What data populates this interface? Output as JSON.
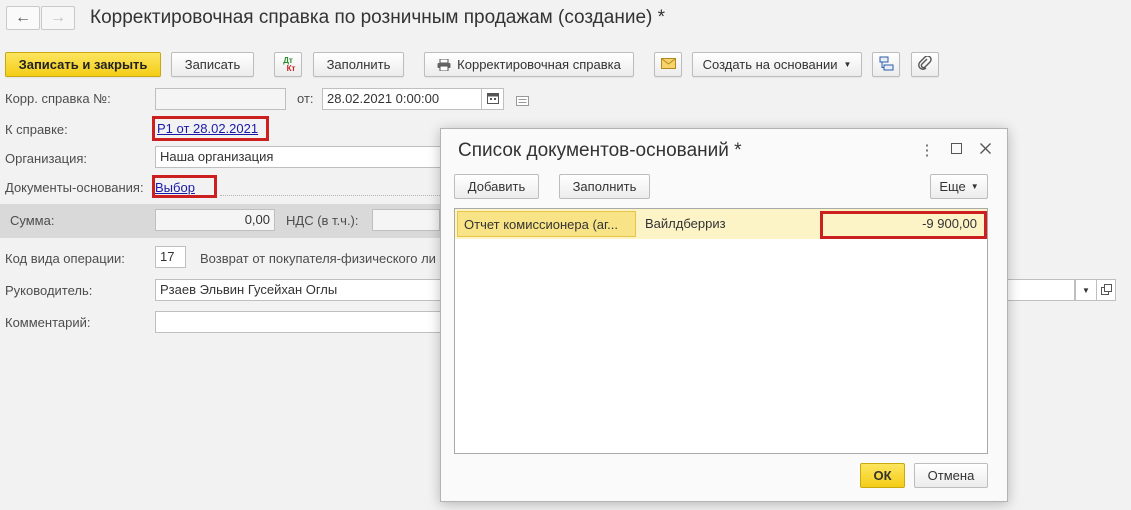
{
  "header": {
    "back_glyph": "←",
    "forward_glyph": "→",
    "title": "Корректировочная справка по розничным продажам (создание) *"
  },
  "toolbar": {
    "save_close": "Записать и закрыть",
    "save": "Записать",
    "dt_kt_top": "Дт",
    "dt_kt_bottom": "Кт",
    "fill": "Заполнить",
    "print_label": "Корректировочная справка",
    "create_based": "Создать на основании"
  },
  "form": {
    "corr_number_label": "Корр. справка №:",
    "corr_number_value": "",
    "date_label": "от:",
    "date_value": "28.02.2021  0:00:00",
    "to_ref_label": "К справке:",
    "to_ref_link": "Р1 от 28.02.2021",
    "org_label": "Организация:",
    "org_value": "Наша организация",
    "base_docs_label": "Документы-основания:",
    "base_docs_link": "Выбор",
    "sum_label": "Сумма:",
    "sum_value": "0,00",
    "vat_label": "НДС (в т.ч.):",
    "op_code_label": "Код вида операции:",
    "op_code_value": "17",
    "op_code_desc": "Возврат от покупателя-физического ли",
    "director_label": "Руководитель:",
    "director_value": "Рзаев Эльвин Гусейхан Оглы",
    "comment_label": "Комментарий:",
    "comment_value": ""
  },
  "dialog": {
    "title": "Список документов-оснований *",
    "add": "Добавить",
    "fill": "Заполнить",
    "more": "Еще",
    "rows": [
      {
        "doc": "Отчет комиссионера (аг...",
        "counterparty": "Вайлдберриз",
        "amount": "-9 900,00"
      }
    ],
    "ok": "ОК",
    "cancel": "Отмена"
  },
  "colors": {
    "primary_button": "#f5cd17",
    "highlight_border": "#cc1f1f",
    "link": "#1a1aa8",
    "selected_row": "#fcf3c7"
  }
}
